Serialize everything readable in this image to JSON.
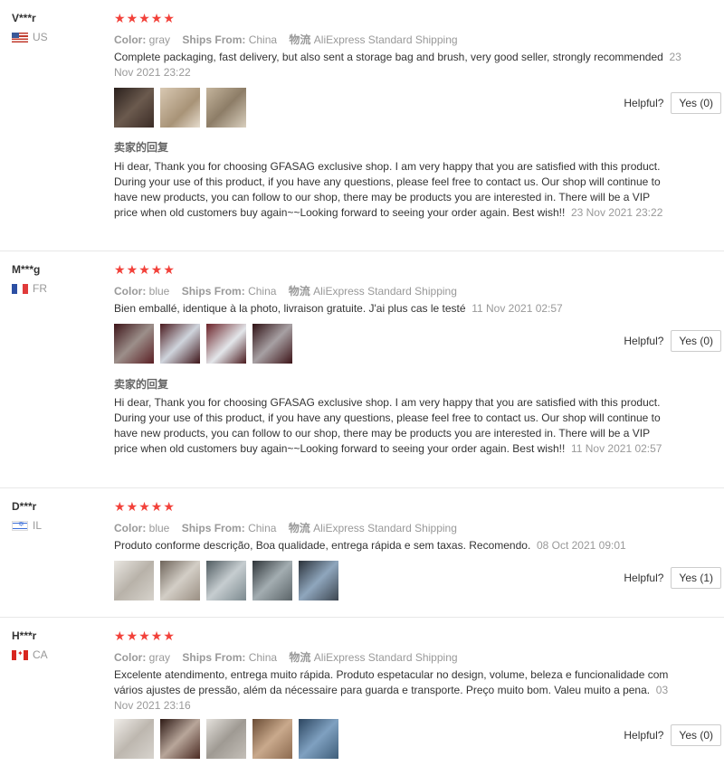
{
  "labels": {
    "color": "Color:",
    "ships_from": "Ships From:",
    "logistics": "物流",
    "reply": "卖家的回复",
    "helpful": "Helpful?"
  },
  "reviews": [
    {
      "user": "V***r",
      "country": "US",
      "flag": "us",
      "color": "gray",
      "ships_from": "China",
      "shipping": "AliExpress Standard Shipping",
      "text": "Complete packaging, fast delivery, but also sent a storage bag and brush, very good seller, strongly recommended",
      "date": "23 Nov 2021 23:22",
      "photos": [
        "#3b2c26",
        "#c9b7a3",
        "#b3a38d"
      ],
      "helpful_label": "Yes (0)",
      "reply_text": "Hi dear, Thank you for choosing GFASAG exclusive shop. I am very happy that you are satisfied with this product. During your use of this product, if you have any questions, please feel free to contact us. Our shop will continue to have new products, you can follow to our shop, there may be products you are interested in. There will be a VIP price when old customers buy again~~Looking forward to seeing your order again. Best wish!!",
      "reply_date": "23 Nov 2021 23:22"
    },
    {
      "user": "M***g",
      "country": "FR",
      "flag": "fr",
      "color": "blue",
      "ships_from": "China",
      "shipping": "AliExpress Standard Shipping",
      "text": "Bien emballé, identique à la photo, livraison gratuite. J'ai plus cas le testé",
      "date": "11 Nov 2021 02:57",
      "photos": [
        "#5a1f24",
        "#4a1a1e",
        "#6b2228",
        "#3d1418"
      ],
      "helpful_label": "Yes (0)",
      "reply_text": "Hi dear, Thank you for choosing GFASAG exclusive shop. I am very happy that you are satisfied with this product. During your use of this product, if you have any questions, please feel free to contact us. Our shop will continue to have new products, you can follow to our shop, there may be products you are interested in. There will be a VIP price when old customers buy again~~Looking forward to seeing your order again. Best wish!!",
      "reply_date": "11 Nov 2021 02:57"
    },
    {
      "user": "D***r",
      "country": "IL",
      "flag": "il",
      "color": "blue",
      "ships_from": "China",
      "shipping": "AliExpress Standard Shipping",
      "text": "Produto conforme descrição, Boa qualidade, entrega rápida e sem taxas. Recomendo.",
      "date": "08 Oct 2021 09:01",
      "photos": [
        "#d6d2cb",
        "#9a8f83",
        "#7c8a8f",
        "#5b6468",
        "#3d4650"
      ],
      "helpful_label": "Yes (1)"
    },
    {
      "user": "H***r",
      "country": "CA",
      "flag": "ca",
      "color": "gray",
      "ships_from": "China",
      "shipping": "AliExpress Standard Shipping",
      "text": "Excelente atendimento, entrega muito rápida. Produto espetacular no design, volume, beleza e funcionalidade com vários ajustes de pressão, além da nécessaire para guarda e transporte. Preço muito bom. Valeu muito a pena.",
      "date": "03 Nov 2021 23:16",
      "photos": [
        "#d7d3cd",
        "#4a2a22",
        "#c4bfb8",
        "#8c6a4f",
        "#3f5e7a"
      ],
      "helpful_label": "Yes (0)"
    }
  ]
}
